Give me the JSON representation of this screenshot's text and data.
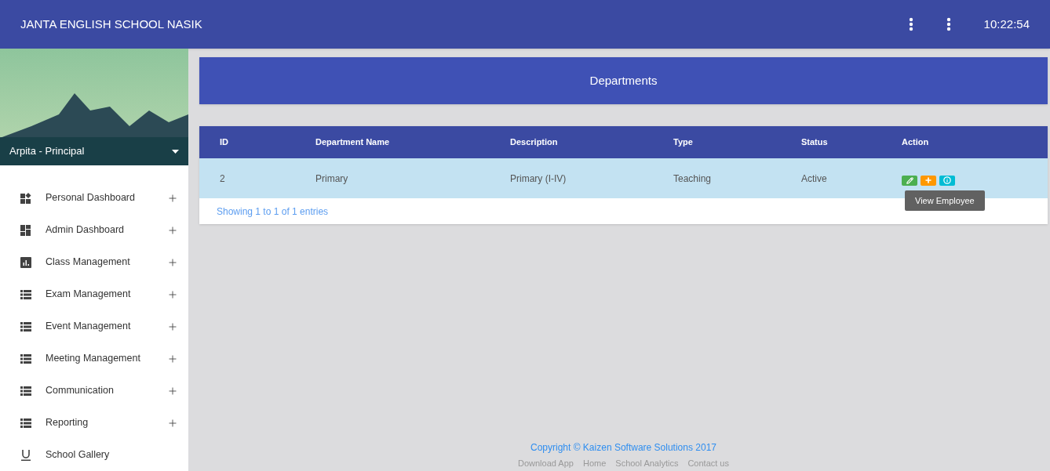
{
  "header": {
    "title": "JANTA ENGLISH SCHOOL NASIK",
    "time": "10:22:54"
  },
  "profile": {
    "name": "Arpita - Principal"
  },
  "sidebar": {
    "items": [
      {
        "label": "Personal Dashboard",
        "kind": "widgets",
        "expandable": true
      },
      {
        "label": "Admin Dashboard",
        "kind": "dashboard",
        "expandable": true
      },
      {
        "label": "Class Management",
        "kind": "chart",
        "expandable": true
      },
      {
        "label": "Exam Management",
        "kind": "list",
        "expandable": true
      },
      {
        "label": "Event Management",
        "kind": "list",
        "expandable": true
      },
      {
        "label": "Meeting Management",
        "kind": "list",
        "expandable": true
      },
      {
        "label": "Communication",
        "kind": "list",
        "expandable": true
      },
      {
        "label": "Reporting",
        "kind": "list",
        "expandable": true
      },
      {
        "label": "School Gallery",
        "kind": "underline",
        "expandable": false
      }
    ]
  },
  "page_title": "Departments",
  "table": {
    "columns": [
      "ID",
      "Department Name",
      "Description",
      "Type",
      "Status",
      "Action"
    ],
    "rows": [
      {
        "cells": [
          "2",
          "Primary",
          "Primary (I-IV)",
          "Teaching",
          "Active"
        ],
        "selected": true
      }
    ],
    "tooltip": "View Employee",
    "info": "Showing 1 to 1 of 1 entries"
  },
  "footer": {
    "copyright": "Copyright © Kaizen Software Solutions 2017",
    "links": [
      "Download App",
      "Home",
      "School Analytics",
      "Contact us"
    ]
  }
}
